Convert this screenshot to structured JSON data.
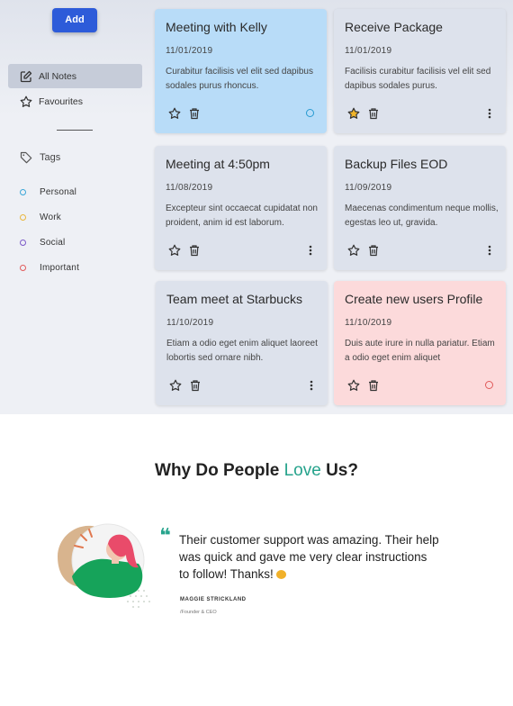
{
  "sidebar": {
    "add_label": "Add",
    "items": [
      {
        "label": "All Notes",
        "icon": "edit-icon",
        "active": true
      },
      {
        "label": "Favourites",
        "icon": "star-icon",
        "active": false
      }
    ],
    "tags_label": "Tags",
    "tags": [
      {
        "label": "Personal",
        "color": "#3aa6d8"
      },
      {
        "label": "Work",
        "color": "#e9b63c"
      },
      {
        "label": "Social",
        "color": "#7b59c8"
      },
      {
        "label": "Important",
        "color": "#e15a5a"
      }
    ]
  },
  "notes": [
    {
      "title": "Meeting with Kelly",
      "date": "11/01/2019",
      "body": "Curabitur facilisis vel elit sed dapibus sodales purus rhoncus.",
      "color": "#b8dcf8",
      "favourite": false,
      "indicator": "circle",
      "indicator_color": "#2a9bd1"
    },
    {
      "title": "Receive Package",
      "date": "11/01/2019",
      "body": "Facilisis curabitur facilisis vel elit sed dapibus sodales purus.",
      "color": "#dde2ec",
      "favourite": true,
      "indicator": "more"
    },
    {
      "title": "Meeting at 4:50pm",
      "date": "11/08/2019",
      "body": "Excepteur sint occaecat cupidatat non proident, anim id est laborum.",
      "color": "#dde2ec",
      "favourite": false,
      "indicator": "more"
    },
    {
      "title": "Backup Files EOD",
      "date": "11/09/2019",
      "body": "Maecenas condimentum neque mollis, egestas leo ut, gravida.",
      "color": "#dde2ec",
      "favourite": false,
      "indicator": "more"
    },
    {
      "title": "Team meet at Starbucks",
      "date": "11/10/2019",
      "body": "Etiam a odio eget enim aliquet laoreet lobortis sed ornare nibh.",
      "color": "#dde2ec",
      "favourite": false,
      "indicator": "more"
    },
    {
      "title": "Create new users Profile",
      "date": "11/10/2019",
      "body": "Duis aute irure in nulla pariatur. Etiam a odio eget enim aliquet",
      "color": "#fcdadb",
      "favourite": false,
      "indicator": "circle",
      "indicator_color": "#e15a5a"
    }
  ],
  "testimonial": {
    "headline_pre": "Why Do People ",
    "headline_accent": "Love",
    "headline_post": " Us?",
    "accent_color": "#26a38c",
    "quote": "Their customer support was amazing. Their help was quick and gave me very clear instructions to follow! Thanks!",
    "author": "MAGGIE STRICKLAND",
    "role": "/Founder & CEO"
  }
}
